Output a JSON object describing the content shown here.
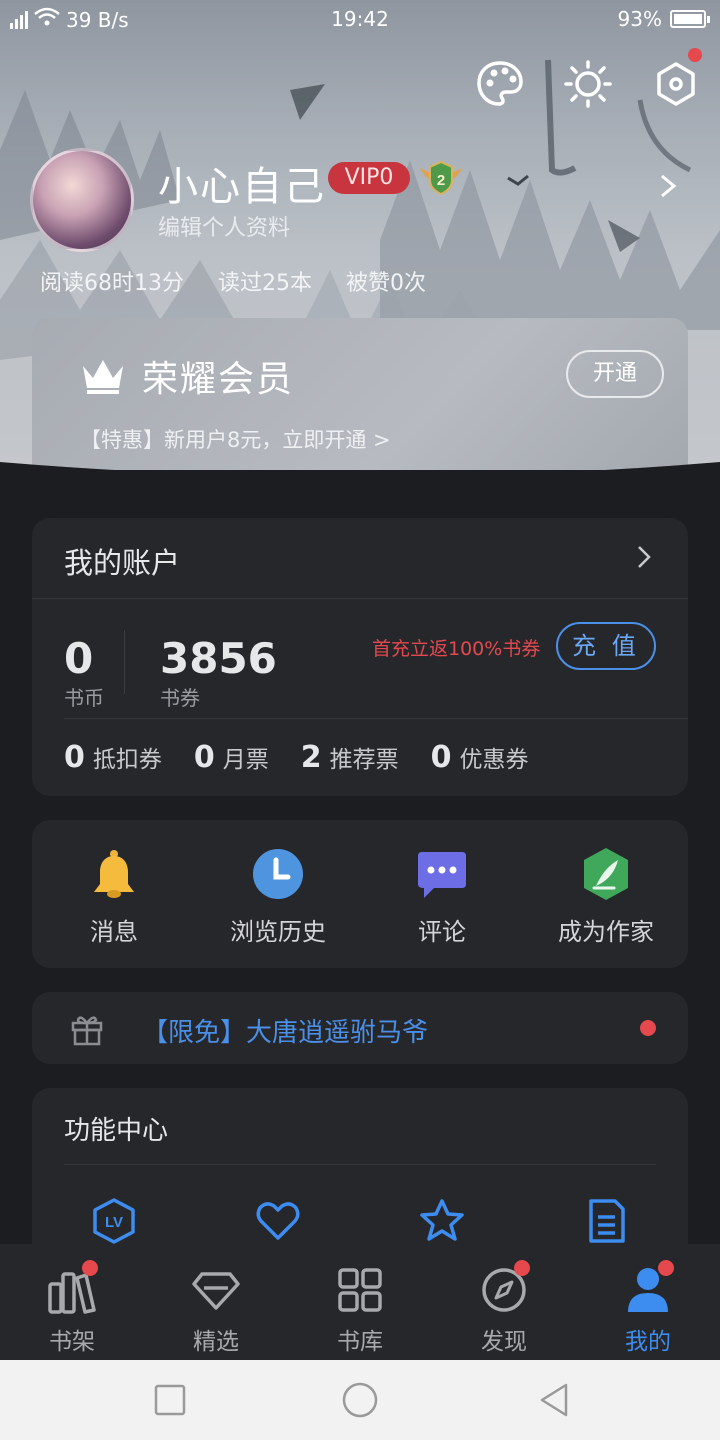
{
  "status_bar": {
    "network": "4G",
    "speed": "39 B/s",
    "time": "19:42",
    "battery": "93%",
    "battery_level": 0.93
  },
  "header": {
    "icons": [
      "palette-icon",
      "brightness-icon",
      "settings-hexagon-icon"
    ]
  },
  "profile": {
    "username": "小心自己",
    "vip_badge": "VIP0",
    "level": "2",
    "edit_label": "编辑个人资料",
    "stats": [
      "阅读68时13分",
      "读过25本",
      "被赞0次"
    ]
  },
  "vip_card": {
    "title": "荣耀会员",
    "open_button": "开通",
    "promo": "【特惠】新用户8元，立即开通 >"
  },
  "account": {
    "title": "我的账户",
    "coins": {
      "value": "0",
      "label": "书币"
    },
    "vouchers": {
      "value": "3856",
      "label": "书券"
    },
    "promo": "首充立返100%书券",
    "recharge_button": "充 值",
    "tickets": [
      {
        "count": "0",
        "label": "抵扣券"
      },
      {
        "count": "0",
        "label": "月票"
      },
      {
        "count": "2",
        "label": "推荐票"
      },
      {
        "count": "0",
        "label": "优惠券"
      }
    ]
  },
  "quick_actions": [
    {
      "label": "消息",
      "icon": "bell-icon"
    },
    {
      "label": "浏览历史",
      "icon": "clock-icon"
    },
    {
      "label": "评论",
      "icon": "comment-icon"
    },
    {
      "label": "成为作家",
      "icon": "quill-icon"
    }
  ],
  "promo_banner": {
    "text": "【限免】大唐逍遥驸马爷",
    "icon": "gift-icon"
  },
  "function_center": {
    "title": "功能中心",
    "icons": [
      "level-icon",
      "heart-icon",
      "star-icon",
      "document-icon"
    ]
  },
  "tabbar": [
    {
      "label": "书架",
      "icon": "bookshelf-icon",
      "badge": true,
      "active": false
    },
    {
      "label": "精选",
      "icon": "diamond-icon",
      "badge": false,
      "active": false
    },
    {
      "label": "书库",
      "icon": "grid-icon",
      "badge": false,
      "active": false
    },
    {
      "label": "发现",
      "icon": "compass-icon",
      "badge": true,
      "active": false
    },
    {
      "label": "我的",
      "icon": "profile-icon",
      "badge": true,
      "active": true
    }
  ],
  "colors": {
    "accent": "#3d8cf0",
    "alert": "#e5484d",
    "vip_red": "#c8353e",
    "card_bg": "#26272b",
    "page_bg": "#1c1d20"
  }
}
